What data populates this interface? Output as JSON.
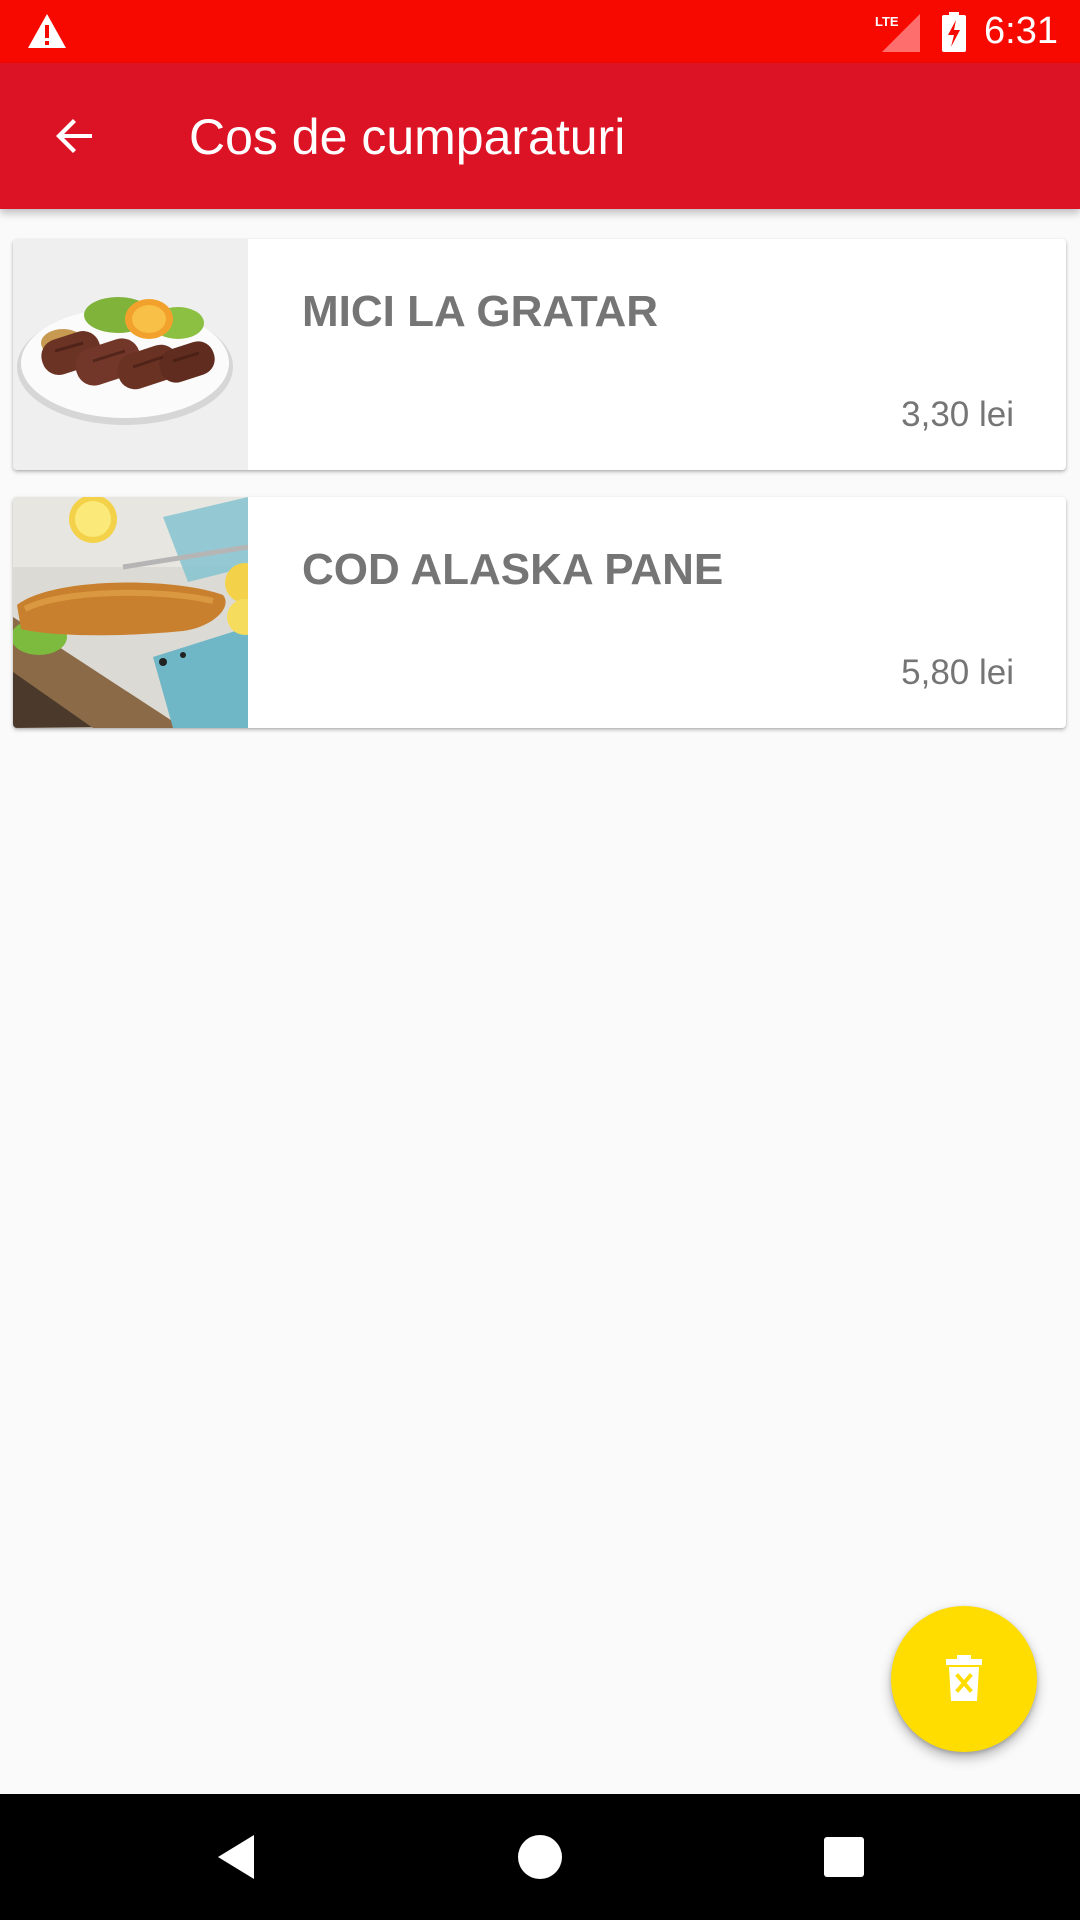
{
  "status_bar": {
    "time": "6:31",
    "network": "LTE",
    "icons": [
      "warning-icon",
      "lte-signal-icon",
      "battery-charging-icon"
    ],
    "color": "#f70900"
  },
  "app_bar": {
    "title": "Cos de cumparaturi",
    "back_icon": "arrow-back-icon",
    "color": "#dc1324"
  },
  "cart": {
    "items": [
      {
        "name": "MICI LA GRATAR",
        "price": "3,30 lei"
      },
      {
        "name": "COD ALASKA PANE",
        "price": "5,80 lei"
      }
    ]
  },
  "fab": {
    "icon": "delete-icon",
    "color": "#ffdd00"
  },
  "nav_bar": {
    "icons": [
      "back-triangle-icon",
      "home-circle-icon",
      "recents-square-icon"
    ]
  }
}
